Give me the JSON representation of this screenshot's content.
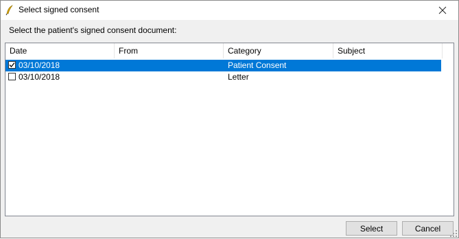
{
  "window": {
    "title": "Select signed consent",
    "close_icon": "close-icon",
    "app_icon": "feather-pen-icon"
  },
  "prompt": "Select the patient's signed consent document:",
  "table": {
    "columns": [
      "Date",
      "From",
      "Category",
      "Subject"
    ],
    "rows": [
      {
        "checked": true,
        "selected": true,
        "date": "03/10/2018",
        "from": "",
        "category": "Patient Consent",
        "subject": ""
      },
      {
        "checked": false,
        "selected": false,
        "date": "03/10/2018",
        "from": "",
        "category": "Letter",
        "subject": ""
      }
    ]
  },
  "buttons": {
    "select_label": "Select",
    "cancel_label": "Cancel"
  },
  "colors": {
    "selection": "#0078d7",
    "dialog_bg": "#f0f0f0"
  }
}
